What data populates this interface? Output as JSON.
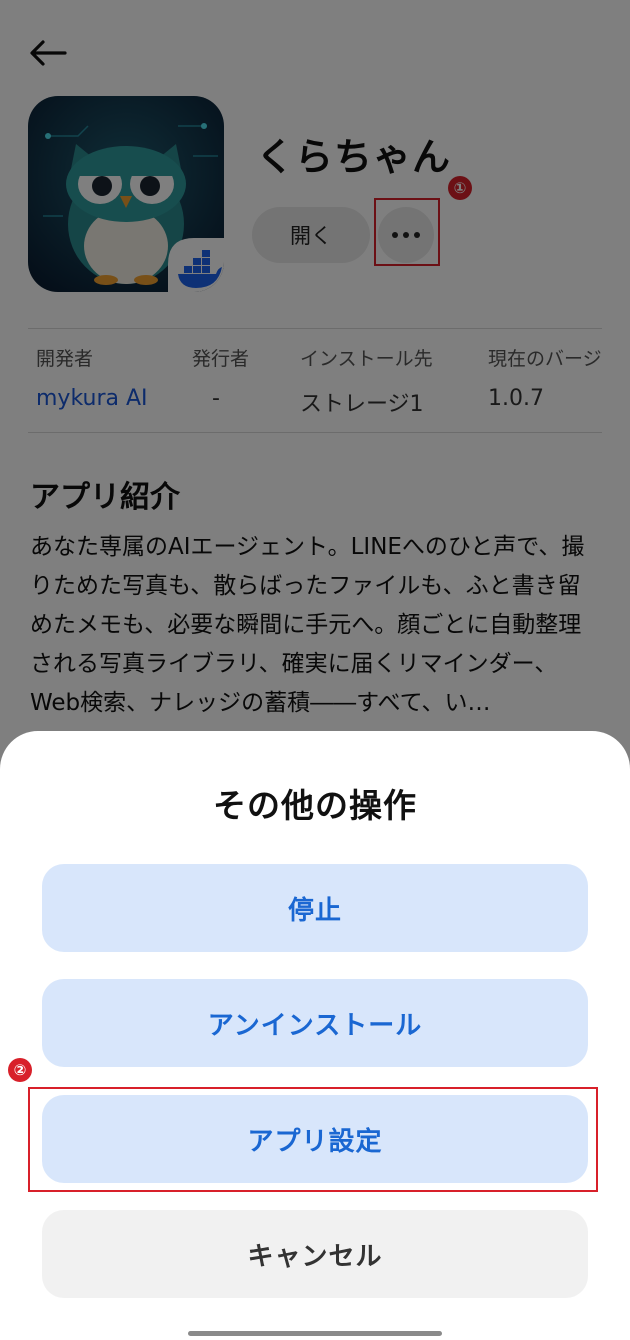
{
  "app": {
    "name": "くらちゃん",
    "open_label": "開く"
  },
  "info": {
    "items": [
      {
        "label": "開発者",
        "value": "mykura AI"
      },
      {
        "label": "発行者",
        "value": "-"
      },
      {
        "label": "インストール先",
        "value": "ストレージ1"
      },
      {
        "label": "現在のバージ",
        "value": "1.0.7"
      }
    ]
  },
  "about": {
    "title": "アプリ紹介",
    "description": "あなた専属のAIエージェント。LINEへのひと声で、撮りためた写真も、散らばったファイルも、ふと書き留めたメモも、必要な瞬間に手元へ。顔ごとに自動整理される写真ライブラリ、確実に届くリマインダー、Web検索、ナレッジの蓄積――すべて、い…"
  },
  "sheet": {
    "title": "その他の操作",
    "buttons": {
      "stop": "停止",
      "uninstall": "アンインストール",
      "settings": "アプリ設定",
      "cancel": "キャンセル"
    }
  },
  "annotations": {
    "marker1": "①",
    "marker2": "②"
  },
  "colors": {
    "accent": "#1a67d2",
    "annotation": "#d8202a",
    "sheet_button_bg": "#d8e6fb"
  },
  "icons": [
    "back-arrow-icon",
    "more-options-icon",
    "docker-badge-icon"
  ]
}
